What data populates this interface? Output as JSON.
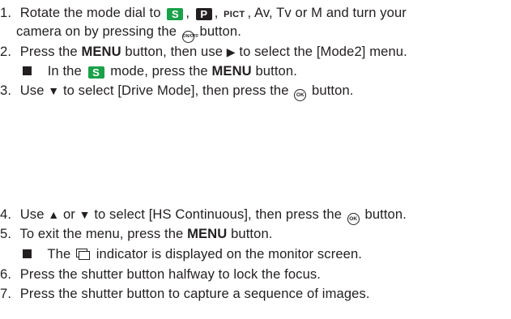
{
  "steps": [
    {
      "num": "1.",
      "a": "Rotate the mode dial to",
      "badge_s": "S",
      "badge_p": "P",
      "pict": "PICT",
      "av": "Av",
      "tv": "Tv",
      "or": "or",
      "m": "M",
      "b": "and turn your",
      "c": "camera on by pressing the",
      "power_icon": "ON/OFF",
      "d": "button."
    },
    {
      "num": "2.",
      "a": "Press the",
      "menu": "MENU",
      "b": "button, then use",
      "arrow": "▶",
      "c": "to select the [Mode2] menu."
    },
    {
      "a": "In the",
      "badge_s": "S",
      "b": "mode, press the",
      "menu": "MENU",
      "c": "button."
    },
    {
      "num": "3.",
      "a": "Use",
      "arrow": "▼",
      "b": "to select [Drive Mode], then press the",
      "ok_icon": "OK",
      "c": "button."
    },
    {
      "num": "4.",
      "a": "Use",
      "up": "▲",
      "or": "or",
      "down": "▼",
      "b": "to select [HS Continuous], then press the",
      "ok_icon": "OK",
      "c": "button."
    },
    {
      "num": "5.",
      "a": "To exit the menu, press the",
      "menu": "MENU",
      "b": "button."
    },
    {
      "a": "The",
      "icon": "continuous-shooting-icon",
      "b": "indicator is displayed on the monitor screen."
    },
    {
      "num": "6.",
      "a": "Press the shutter button halfway to lock the focus."
    },
    {
      "num": "7.",
      "a": "Press the shutter button to capture a sequence of images."
    }
  ]
}
